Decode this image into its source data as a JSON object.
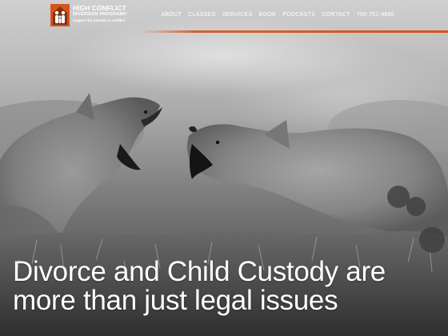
{
  "logo": {
    "line1": "HIGH CONFLICT",
    "line2": "DIVERSION PROGRAM",
    "registered": "®",
    "tagline": "support for parents in conflict",
    "icon": "family-silhouette-icon",
    "color": "#d6541c"
  },
  "nav": {
    "items": [
      "ABOUT",
      "CLASSES",
      "SERVICES",
      "BOOK",
      "PODCASTS",
      "CONTACT",
      "760-751-4886"
    ]
  },
  "hero": {
    "image": "two-foxes-fighting-photo",
    "headline_line1": "Divorce and Child Custody are",
    "headline_line2": "more than just legal issues"
  },
  "colors": {
    "accent": "#d6541c",
    "text": "#ffffff"
  }
}
